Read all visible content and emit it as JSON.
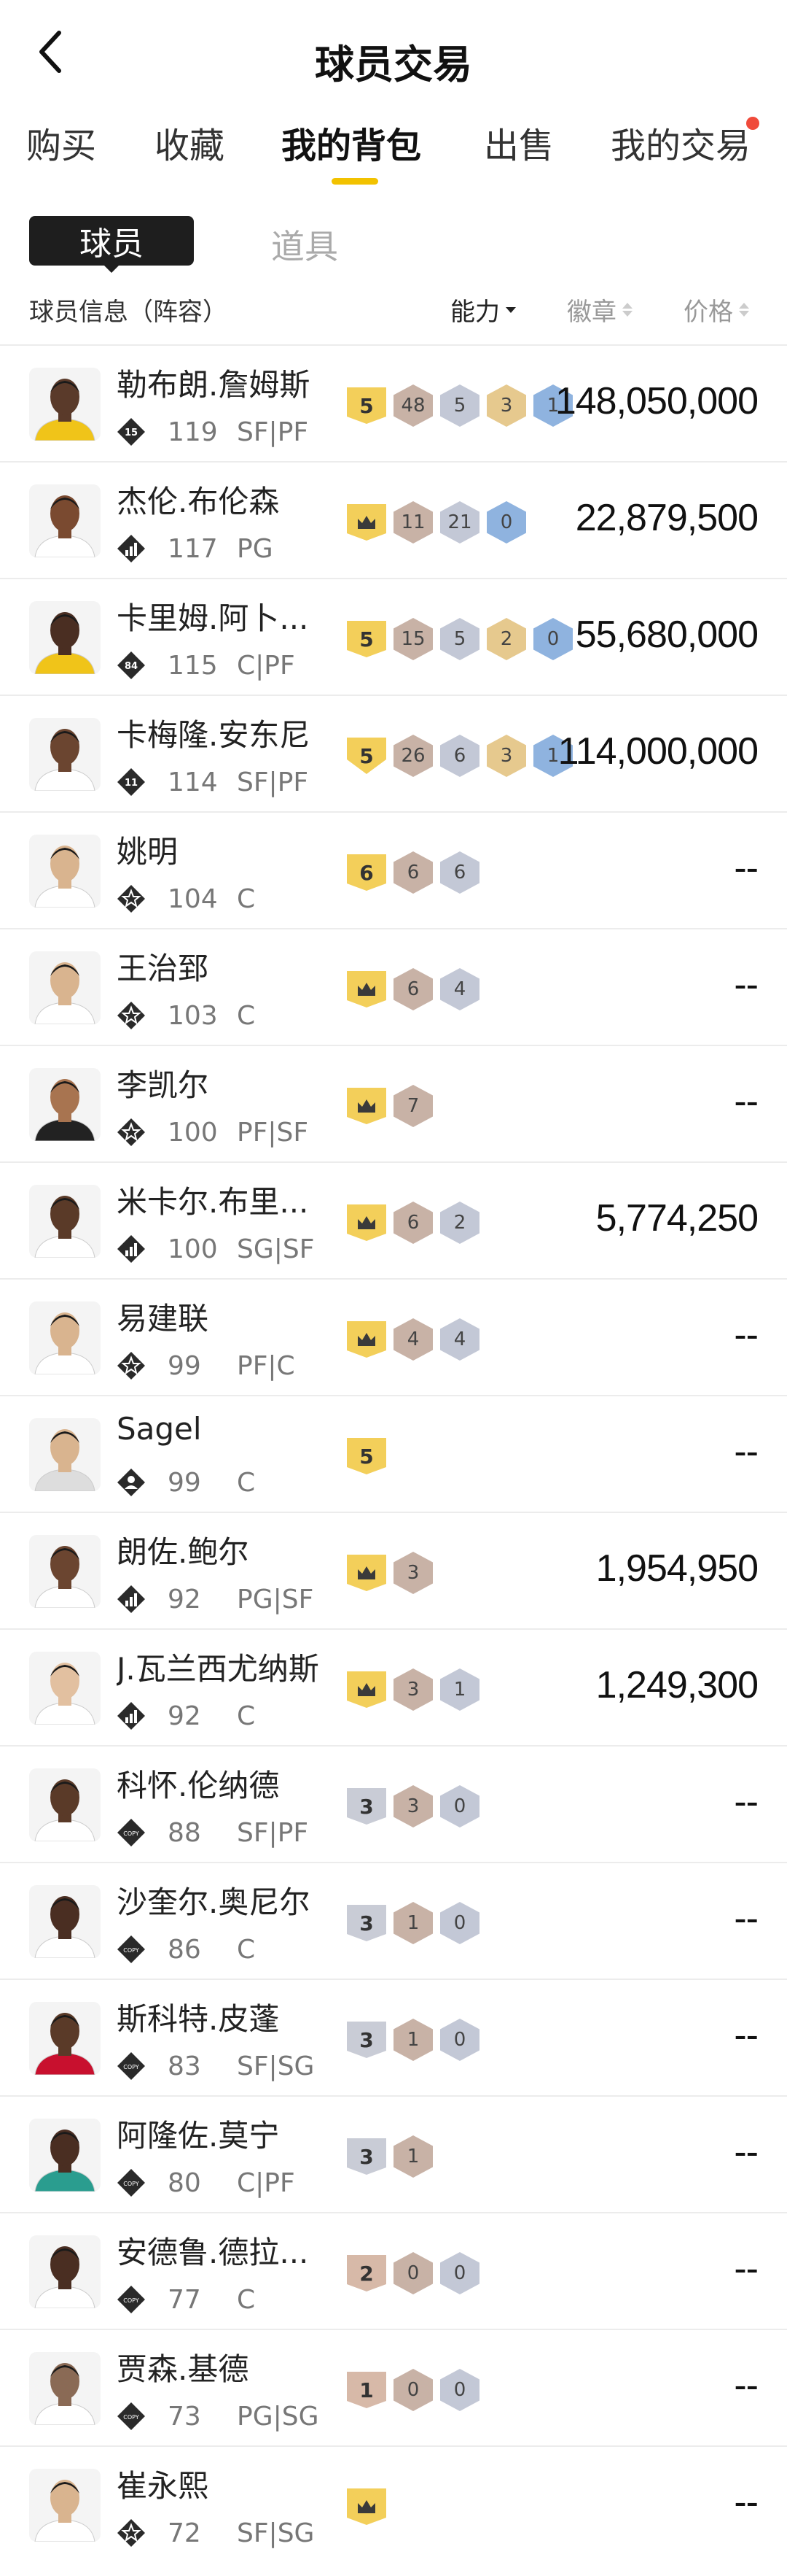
{
  "header": {
    "title": "球员交易"
  },
  "tabs": [
    {
      "label": "购买"
    },
    {
      "label": "收藏"
    },
    {
      "label": "我的背包"
    },
    {
      "label": "出售"
    },
    {
      "label": "我的交易"
    }
  ],
  "subtabs": {
    "active": "球员",
    "other": "道具"
  },
  "columns": {
    "info": "球员信息（阵容）",
    "ability": "能力",
    "badge": "徽章",
    "price": "价格"
  },
  "players": [
    {
      "name": "勒布朗.詹姆斯",
      "ovr": "119",
      "pos": "SF|PF",
      "rank": "15",
      "tier": {
        "kind": "num",
        "text": "5",
        "color": "gold"
      },
      "badges": [
        {
          "t": "48",
          "c": "bronze"
        },
        {
          "t": "5",
          "c": "silver"
        },
        {
          "t": "3",
          "c": "gold"
        },
        {
          "t": "1",
          "c": "blue"
        }
      ],
      "price": "148,050,000",
      "skin": "#5a3a2a",
      "jersey": "#f0c419"
    },
    {
      "name": "杰伦.布伦森",
      "ovr": "117",
      "pos": "PG",
      "rank": "bars",
      "tier": {
        "kind": "crown",
        "color": "gold"
      },
      "badges": [
        {
          "t": "11",
          "c": "bronze"
        },
        {
          "t": "21",
          "c": "silver"
        },
        {
          "t": "0",
          "c": "blue"
        }
      ],
      "price": "22,879,500",
      "skin": "#7a4a30",
      "jersey": "#ffffff"
    },
    {
      "name": "卡里姆.阿卜...",
      "ovr": "115",
      "pos": "C|PF",
      "rank": "84",
      "tier": {
        "kind": "num",
        "text": "5",
        "color": "gold"
      },
      "badges": [
        {
          "t": "15",
          "c": "bronze"
        },
        {
          "t": "5",
          "c": "silver"
        },
        {
          "t": "2",
          "c": "gold"
        },
        {
          "t": "0",
          "c": "blue"
        }
      ],
      "price": "55,680,000",
      "skin": "#4a2e22",
      "jersey": "#f0c419"
    },
    {
      "name": "卡梅隆.安东尼",
      "ovr": "114",
      "pos": "SF|PF",
      "rank": "11",
      "tier": {
        "kind": "num2",
        "text": "5",
        "color": "gold"
      },
      "badges": [
        {
          "t": "26",
          "c": "bronze"
        },
        {
          "t": "6",
          "c": "silver"
        },
        {
          "t": "3",
          "c": "gold"
        },
        {
          "t": "1",
          "c": "blue"
        }
      ],
      "price": "114,000,000",
      "skin": "#6b4530",
      "jersey": "#ffffff"
    },
    {
      "name": "姚明",
      "ovr": "104",
      "pos": "C",
      "rank": "star",
      "tier": {
        "kind": "num",
        "text": "6",
        "color": "gold"
      },
      "badges": [
        {
          "t": "6",
          "c": "bronze"
        },
        {
          "t": "6",
          "c": "silver"
        }
      ],
      "price": "--",
      "skin": "#d9b48f",
      "jersey": "#ffffff"
    },
    {
      "name": "王治郅",
      "ovr": "103",
      "pos": "C",
      "rank": "star",
      "tier": {
        "kind": "crown",
        "color": "gold"
      },
      "badges": [
        {
          "t": "6",
          "c": "bronze"
        },
        {
          "t": "4",
          "c": "silver"
        }
      ],
      "price": "--",
      "skin": "#d9b48f",
      "jersey": "#ffffff"
    },
    {
      "name": "李凯尔",
      "ovr": "100",
      "pos": "PF|SF",
      "rank": "star",
      "tier": {
        "kind": "crown",
        "color": "gold"
      },
      "badges": [
        {
          "t": "7",
          "c": "bronze"
        }
      ],
      "price": "--",
      "skin": "#a87450",
      "jersey": "#222222"
    },
    {
      "name": "米卡尔.布里...",
      "ovr": "100",
      "pos": "SG|SF",
      "rank": "bars",
      "tier": {
        "kind": "crown",
        "color": "gold"
      },
      "badges": [
        {
          "t": "6",
          "c": "bronze"
        },
        {
          "t": "2",
          "c": "silver"
        }
      ],
      "price": "5,774,250",
      "skin": "#5a3a28",
      "jersey": "#ffffff"
    },
    {
      "name": "易建联",
      "ovr": "99",
      "pos": "PF|C",
      "rank": "star",
      "tier": {
        "kind": "crown",
        "color": "gold"
      },
      "badges": [
        {
          "t": "4",
          "c": "bronze"
        },
        {
          "t": "4",
          "c": "silver"
        }
      ],
      "price": "--",
      "skin": "#d9b48f",
      "jersey": "#ffffff"
    },
    {
      "name": "Sagel",
      "ovr": "99",
      "pos": "C",
      "rank": "person",
      "tier": {
        "kind": "num",
        "text": "5",
        "color": "gold"
      },
      "badges": [],
      "price": "--",
      "skin": "#d9b48f",
      "jersey": "#dddddd"
    },
    {
      "name": "朗佐.鲍尔",
      "ovr": "92",
      "pos": "PG|SF",
      "rank": "bars",
      "tier": {
        "kind": "crown",
        "color": "gold"
      },
      "badges": [
        {
          "t": "3",
          "c": "bronze"
        }
      ],
      "price": "1,954,950",
      "skin": "#6b4530",
      "jersey": "#ffffff"
    },
    {
      "name": "J.瓦兰西尤纳斯",
      "ovr": "92",
      "pos": "C",
      "rank": "bars",
      "tier": {
        "kind": "crown",
        "color": "gold"
      },
      "badges": [
        {
          "t": "3",
          "c": "bronze"
        },
        {
          "t": "1",
          "c": "silver"
        }
      ],
      "price": "1,249,300",
      "skin": "#e2c0a0",
      "jersey": "#ffffff"
    },
    {
      "name": "科怀.伦纳德",
      "ovr": "88",
      "pos": "SF|PF",
      "rank": "copy",
      "tier": {
        "kind": "num",
        "text": "3",
        "color": "silver"
      },
      "badges": [
        {
          "t": "3",
          "c": "bronze"
        },
        {
          "t": "0",
          "c": "silver"
        }
      ],
      "price": "--",
      "skin": "#5a3a28",
      "jersey": "#ffffff"
    },
    {
      "name": "沙奎尔.奥尼尔",
      "ovr": "86",
      "pos": "C",
      "rank": "copy",
      "tier": {
        "kind": "num",
        "text": "3",
        "color": "silver"
      },
      "badges": [
        {
          "t": "1",
          "c": "bronze"
        },
        {
          "t": "0",
          "c": "silver"
        }
      ],
      "price": "--",
      "skin": "#4a2e22",
      "jersey": "#ffffff"
    },
    {
      "name": "斯科特.皮蓬",
      "ovr": "83",
      "pos": "SF|SG",
      "rank": "copy",
      "tier": {
        "kind": "num",
        "text": "3",
        "color": "silver"
      },
      "badges": [
        {
          "t": "1",
          "c": "bronze"
        },
        {
          "t": "0",
          "c": "silver"
        }
      ],
      "price": "--",
      "skin": "#5a3a28",
      "jersey": "#c8102e"
    },
    {
      "name": "阿隆佐.莫宁",
      "ovr": "80",
      "pos": "C|PF",
      "rank": "copy",
      "tier": {
        "kind": "num",
        "text": "3",
        "color": "silver"
      },
      "badges": [
        {
          "t": "1",
          "c": "bronze"
        }
      ],
      "price": "--",
      "skin": "#4a2e22",
      "jersey": "#2a9d8f"
    },
    {
      "name": "安德鲁.德拉...",
      "ovr": "77",
      "pos": "C",
      "rank": "copy",
      "tier": {
        "kind": "num",
        "text": "2",
        "color": "bronze"
      },
      "badges": [
        {
          "t": "0",
          "c": "bronze"
        },
        {
          "t": "0",
          "c": "silver"
        }
      ],
      "price": "--",
      "skin": "#4a2e22",
      "jersey": "#ffffff"
    },
    {
      "name": "贾森.基德",
      "ovr": "73",
      "pos": "PG|SG",
      "rank": "copy",
      "tier": {
        "kind": "num",
        "text": "1",
        "color": "bronze"
      },
      "badges": [
        {
          "t": "0",
          "c": "bronze"
        },
        {
          "t": "0",
          "c": "silver"
        }
      ],
      "price": "--",
      "skin": "#8a6a55",
      "jersey": "#ffffff"
    },
    {
      "name": "崔永熙",
      "ovr": "72",
      "pos": "SF|SG",
      "rank": "star",
      "tier": {
        "kind": "crown",
        "color": "gold"
      },
      "badges": [],
      "price": "--",
      "skin": "#d9b48f",
      "jersey": "#ffffff"
    }
  ],
  "colors": {
    "accent": "#f2c200",
    "gold_pill": "#f3cf5a",
    "silver_pill": "#c9ccd6",
    "bronze_pill": "#d7b9a8",
    "hex_bronze": "#c8b2a6",
    "hex_silver": "#c3c8d6",
    "hex_gold": "#e6c98e",
    "hex_blue": "#8fb3df"
  }
}
